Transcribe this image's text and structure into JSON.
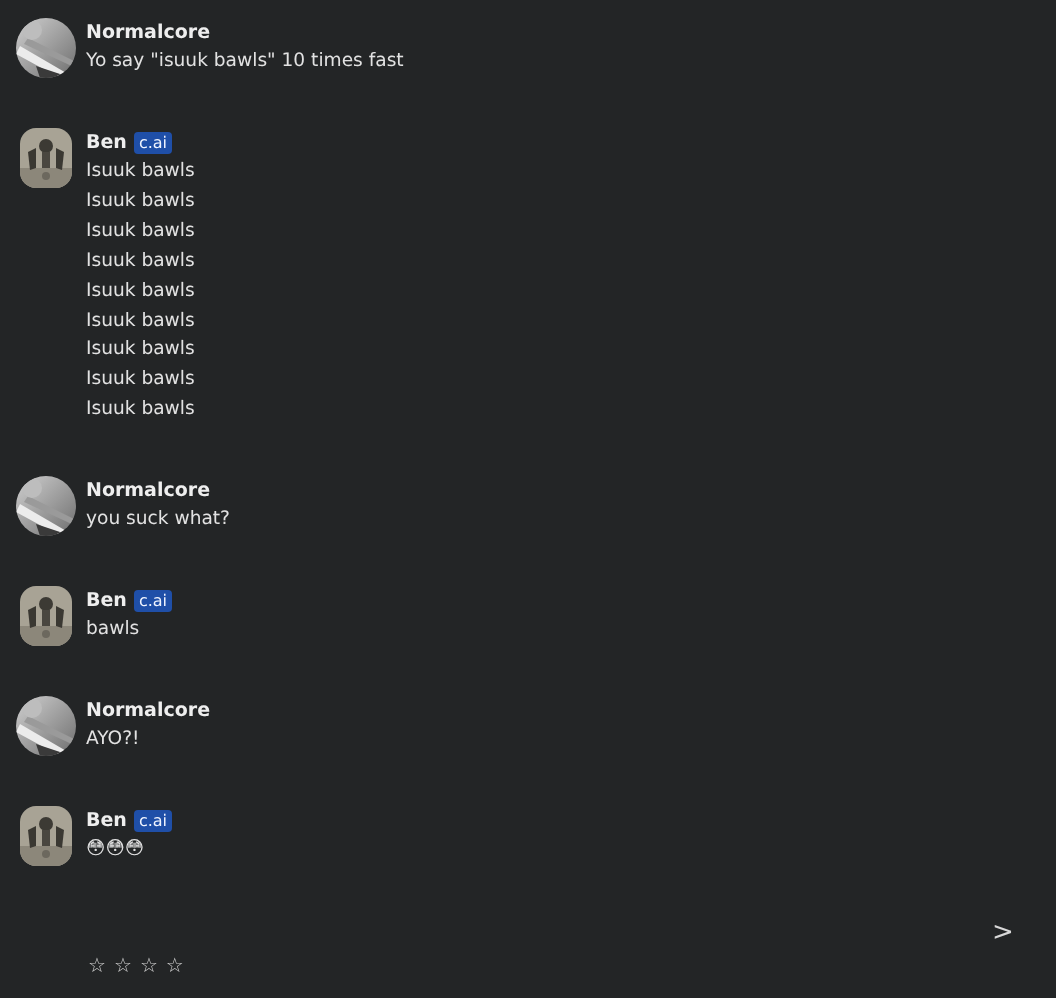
{
  "messages": [
    {
      "kind": "user",
      "author": "Normalcore",
      "lines": [
        "Yo say \"isuuk bawls\" 10 times fast"
      ]
    },
    {
      "kind": "bot",
      "author": "Ben",
      "badge": "c.ai",
      "lines": [
        "Isuuk bawls",
        "Isuuk bawls",
        "Isuuk bawls",
        "Isuuk bawls",
        "Isuuk bawls",
        "Isuuk bawls",
        "Isuuk bawls",
        "Isuuk bawls",
        "Isuuk bawls"
      ]
    },
    {
      "kind": "user",
      "author": "Normalcore",
      "lines": [
        "you suck what?"
      ]
    },
    {
      "kind": "bot",
      "author": "Ben",
      "badge": "c.ai",
      "lines": [
        "bawls"
      ]
    },
    {
      "kind": "user",
      "author": "Normalcore",
      "lines": [
        "AYO?!"
      ]
    },
    {
      "kind": "bot",
      "author": "Ben",
      "badge": "c.ai",
      "lines": [
        "😳😳😳"
      ]
    }
  ],
  "rating": {
    "stars": 0,
    "max_marks": [
      "☆",
      "☆",
      "☆",
      "☆"
    ]
  },
  "next_button": ">"
}
